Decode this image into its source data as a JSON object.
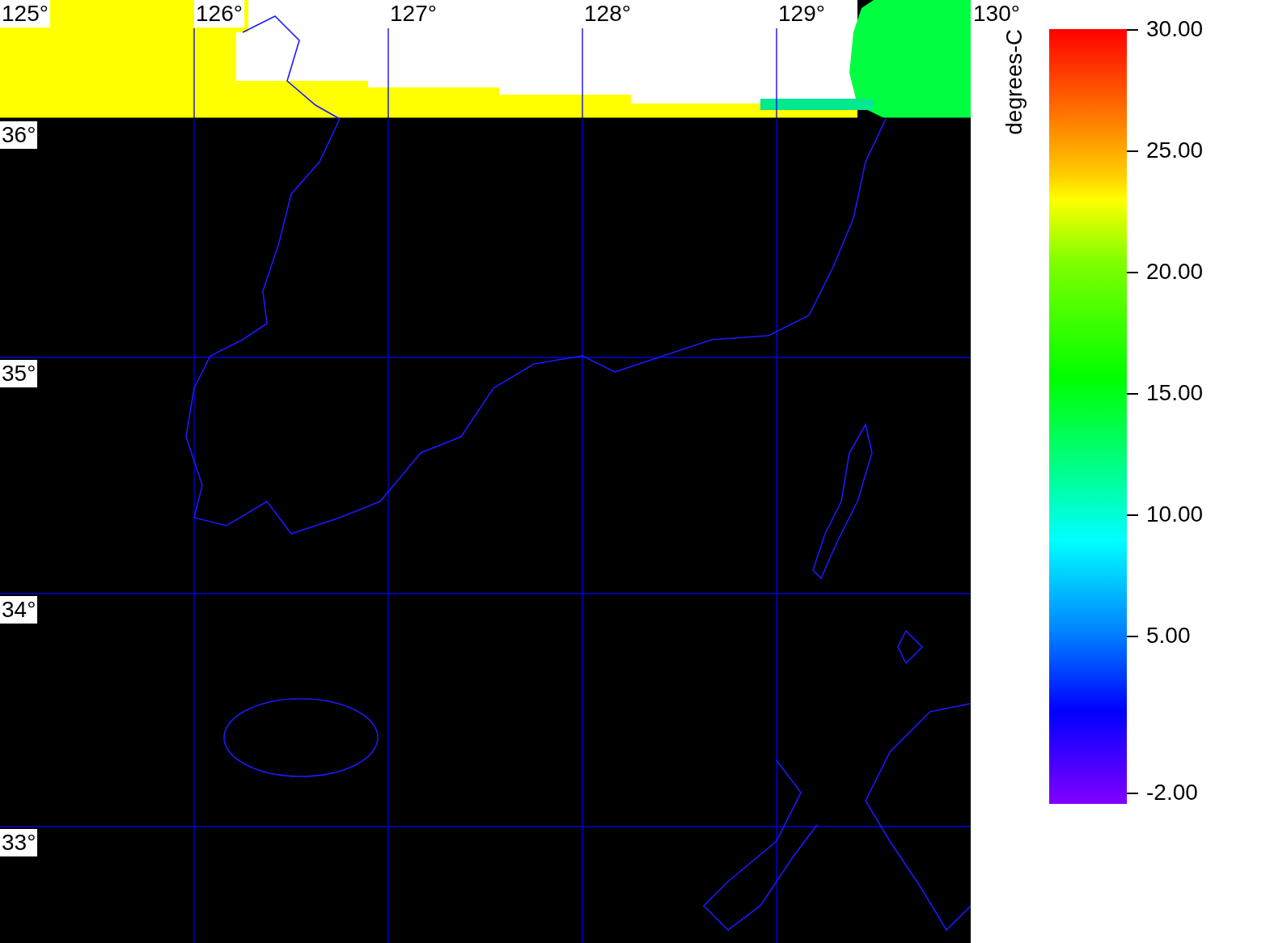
{
  "map": {
    "longitude_labels": [
      "125°",
      "126°",
      "127°",
      "128°",
      "129°",
      "130°"
    ],
    "latitude_labels": [
      "36°",
      "35°",
      "34°",
      "33°"
    ]
  },
  "colorbar": {
    "title": "degrees-C",
    "tick_labels": [
      "30.00",
      "25.00",
      "20.00",
      "15.00",
      "10.00",
      "5.00",
      "-2.00"
    ]
  }
}
